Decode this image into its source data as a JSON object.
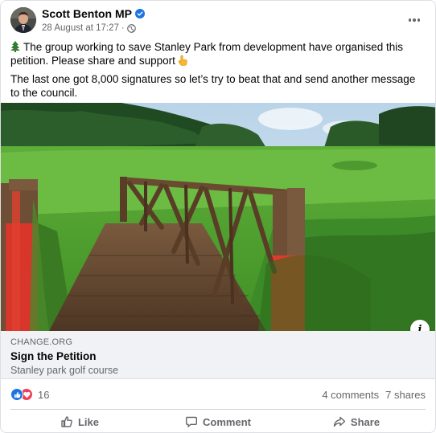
{
  "post": {
    "author": "Scott Benton MP",
    "timestamp": "28 August at 17:27",
    "meta_separator": "·",
    "paragraphs": [
      "The group working to save Stanley Park from development have organised this petition. Please share and support",
      "The last one got 8,000 signatures so let’s try to beat that and send another message to the council."
    ],
    "icons": {
      "verified": "verified-badge-icon",
      "audience": "globe-icon",
      "options": "more-options-icon",
      "emoji_1": "evergreen-tree-icon",
      "emoji_2": "pointing-hand-icon"
    }
  },
  "link_preview": {
    "domain": "CHANGE.ORG",
    "title": "Sign the Petition",
    "subtitle": "Stanley park golf course",
    "info_label": "i"
  },
  "stats": {
    "reaction_count": "16",
    "comments": "4 comments",
    "shares": "7 shares",
    "reactions": [
      "like",
      "love"
    ]
  },
  "actions": {
    "like": "Like",
    "comment": "Comment",
    "share": "Share"
  },
  "colors": {
    "brand_blue": "#1b74e4",
    "love_red": "#f33e58",
    "secondary_text": "#65676b",
    "link_box_bg": "#f0f2f5"
  }
}
